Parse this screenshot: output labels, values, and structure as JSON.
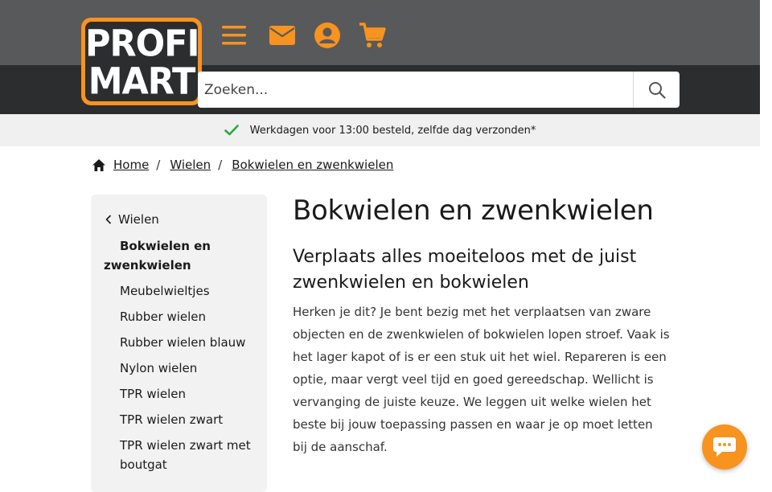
{
  "brand": {
    "logo_line1": "PROFI",
    "logo_line2": "MART",
    "accent_color": "#f7931e",
    "header_color": "#58595b",
    "band_color": "#2b2d2f"
  },
  "header": {
    "icons": [
      "menu-icon",
      "mail-icon",
      "account-icon",
      "cart-icon"
    ]
  },
  "search": {
    "placeholder": "Zoeken...",
    "value": ""
  },
  "usp": {
    "text": "Werkdagen voor 13:00 besteld, zelfde dag verzonden*"
  },
  "breadcrumb": {
    "items": [
      "Home",
      "Wielen",
      "Bokwielen en zwenkwielen"
    ]
  },
  "sidebar": {
    "back_label": "Wielen",
    "items": [
      {
        "label": "Bokwielen en zwenkwielen",
        "active": true
      },
      {
        "label": "Meubelwieltjes"
      },
      {
        "label": "Rubber wielen"
      },
      {
        "label": "Rubber wielen blauw"
      },
      {
        "label": "Nylon wielen"
      },
      {
        "label": "TPR wielen"
      },
      {
        "label": "TPR wielen zwart"
      },
      {
        "label": "TPR wielen zwart met boutgat"
      }
    ]
  },
  "main": {
    "title": "Bokwielen en zwenkwielen",
    "subtitle": "Verplaats alles moeiteloos met de juist zwenkwielen en bokwielen",
    "intro": "Herken je dit? Je bent bezig met het verplaatsen van zware objecten en de zwenkwielen of bokwielen lopen stroef. Vaak is het lager kapot of is er een stuk uit het wiel. Repareren is een optie, maar vergt veel tijd en goed gereedschap. Wellicht is vervanging de juiste keuze. We leggen uit welke wielen het beste bij jouw toepassing passen en waar je op moet letten bij de aanschaf."
  }
}
